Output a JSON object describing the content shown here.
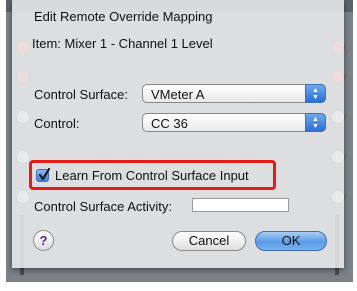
{
  "dialog": {
    "title": "Edit Remote Override Mapping",
    "item_line": "Item: Mixer 1 - Channel 1 Level"
  },
  "fields": {
    "control_surface_label": "Control Surface:",
    "control_surface_value": "VMeter A",
    "control_label": "Control:",
    "control_value": "CC 36"
  },
  "learn": {
    "label": "Learn From Control Surface Input",
    "checked": true,
    "highlight_color": "#e21b1b"
  },
  "activity": {
    "label": "Control Surface Activity:",
    "value": ""
  },
  "buttons": {
    "help_glyph": "?",
    "cancel_label": "Cancel",
    "ok_label": "OK"
  },
  "colors": {
    "accent": "#3d7fdc"
  }
}
